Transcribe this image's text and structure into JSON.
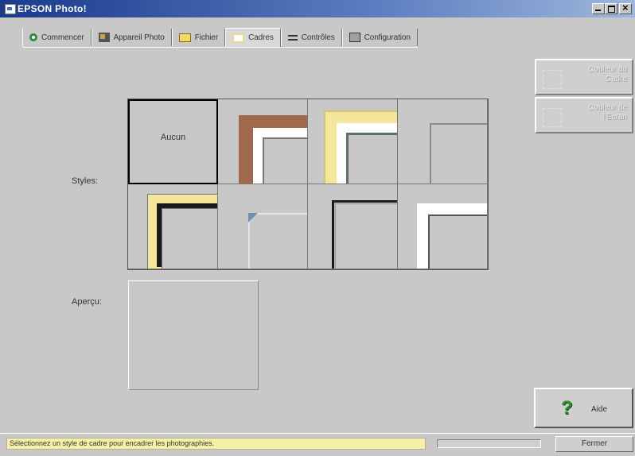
{
  "window": {
    "title": "EPSON Photo!"
  },
  "tabs": [
    {
      "label": "Commencer",
      "icon": "start-icon",
      "active": false
    },
    {
      "label": "Appareil Photo",
      "icon": "camera-icon",
      "active": false
    },
    {
      "label": "Fichier",
      "icon": "folder-icon",
      "active": false
    },
    {
      "label": "Cadres",
      "icon": "frame-icon",
      "active": true
    },
    {
      "label": "Contrôles",
      "icon": "controls-icon",
      "active": false
    },
    {
      "label": "Configuration",
      "icon": "config-icon",
      "active": false
    }
  ],
  "side_buttons": {
    "frame_color": "Couleur du Cadre",
    "background_color": "Couleur de l'Écran"
  },
  "styles": {
    "label": "Styles:",
    "none_label": "Aucun",
    "selected_index": 0,
    "frames": [
      {
        "name": "none"
      },
      {
        "name": "brown-white",
        "colors": [
          "#a0694c",
          "#ffffff"
        ]
      },
      {
        "name": "yellow-bevel",
        "colors": [
          "#f5e79a",
          "#ffffff",
          "#5e6e6e"
        ]
      },
      {
        "name": "gray-thin",
        "colors": [
          "#8a8a8a"
        ]
      },
      {
        "name": "yellow-black",
        "colors": [
          "#f5e79a",
          "#1a1a1a"
        ]
      },
      {
        "name": "blue-corner",
        "colors": [
          "#6f8fb5",
          "#e6e6e6"
        ]
      },
      {
        "name": "black-line",
        "colors": [
          "#1a1a1a",
          "#9a9a9a"
        ]
      },
      {
        "name": "white-border",
        "colors": [
          "#ffffff",
          "#555555"
        ]
      }
    ]
  },
  "preview": {
    "label": "Aperçu:"
  },
  "help": {
    "label": "Aide"
  },
  "status": {
    "message": "Sélectionnez un style de cadre pour encadrer les photographies.",
    "close_label": "Fermer"
  }
}
